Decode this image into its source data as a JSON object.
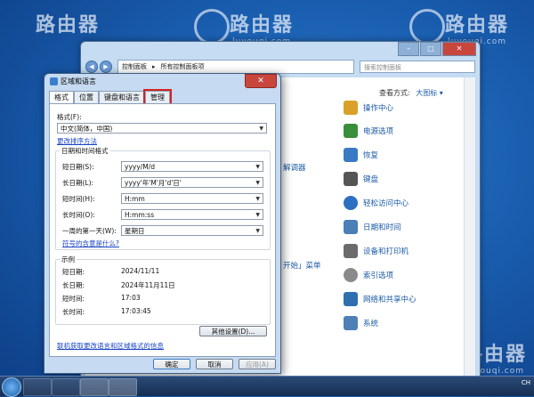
{
  "watermark": {
    "name": "路由器",
    "sub": "luyouqi.com"
  },
  "control_panel": {
    "address_parts": [
      "控制面板",
      "所有控制面板项"
    ],
    "search_placeholder": "搜索控制面板",
    "view_by_label": "查看方式:",
    "view_by_value": "大图标 ▾",
    "left_items": [
      {
        "label": "解调器"
      },
      {
        "label": "开始」菜单"
      }
    ],
    "items": [
      {
        "label": "操作中心",
        "color": "#d9a12a"
      },
      {
        "label": "电源选项",
        "color": "#3a8f3a"
      },
      {
        "label": "恢复",
        "color": "#3a7ac4"
      },
      {
        "label": "键盘",
        "color": "#555555"
      },
      {
        "label": "轻松访问中心",
        "color": "#2d6fc0"
      },
      {
        "label": "日期和时间",
        "color": "#4a7fb8"
      },
      {
        "label": "设备和打印机",
        "color": "#6b6b6b"
      },
      {
        "label": "索引选项",
        "color": "#8a8a8a"
      },
      {
        "label": "网络和共享中心",
        "color": "#2f6fb0"
      },
      {
        "label": "系统",
        "color": "#4e7fb6"
      }
    ]
  },
  "dialog": {
    "title": "区域和语言",
    "close_label": "✕",
    "tabs": [
      "格式",
      "位置",
      "键盘和语言",
      "管理"
    ],
    "format_label": "格式(F):",
    "format_value": "中文(简体，中国)",
    "change_sort_link": "更改排序方法",
    "date_time_group": "日期和时间格式",
    "fields": [
      {
        "label": "短日期(S):",
        "value": "yyyy/M/d"
      },
      {
        "label": "长日期(L):",
        "value": "yyyy'年'M'月'd'日'"
      },
      {
        "label": "短时间(H):",
        "value": "H:mm"
      },
      {
        "label": "长时间(O):",
        "value": "H:mm:ss"
      },
      {
        "label": "一周的第一天(W):",
        "value": "星期日"
      }
    ],
    "symbol_link": "符号的含意是什么?",
    "examples_group": "示例",
    "examples": [
      {
        "label": "短日期:",
        "value": "2024/11/11"
      },
      {
        "label": "长日期:",
        "value": "2024年11月11日"
      },
      {
        "label": "短时间:",
        "value": "17:03"
      },
      {
        "label": "长时间:",
        "value": "17:03:45"
      }
    ],
    "other_settings_button": "其他设置(D)...",
    "online_link": "联机获取更改语言和区域格式的信息",
    "ok_button": "确定",
    "cancel_button": "取消",
    "apply_button": "应用(A)"
  },
  "taskbar": {
    "tray_text": "CH"
  }
}
